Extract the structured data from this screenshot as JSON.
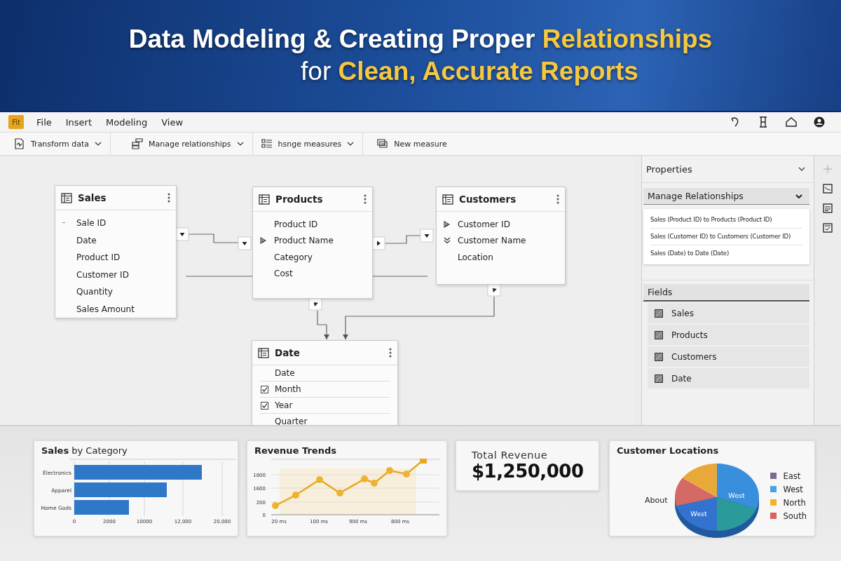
{
  "banner": {
    "lines": [
      [
        {
          "text": "Data Modeling & Creating Proper ",
          "highlight": false
        },
        {
          "text": "Relationships",
          "highlight": true
        }
      ],
      [
        {
          "text": "for ",
          "highlight": false
        },
        {
          "text": "Clean, Accurate Reports",
          "highlight": true
        }
      ]
    ]
  },
  "app_logo": "Fit",
  "menu": [
    "File",
    "Insert",
    "Modeling",
    "View"
  ],
  "toolbar": [
    {
      "label": "Transform data",
      "dropdown": true
    },
    {
      "label": "Manage relationships",
      "dropdown": true
    },
    {
      "label": "hsnge measures",
      "dropdown": true
    },
    {
      "label": "New measure",
      "dropdown": false
    }
  ],
  "tables": [
    {
      "name": "Sales",
      "fields": [
        {
          "label": "Sale ID",
          "kind": "dash"
        },
        {
          "label": "Date",
          "kind": "plain"
        },
        {
          "label": "Product ID",
          "kind": "plain"
        },
        {
          "label": "Customer ID",
          "kind": "plain"
        },
        {
          "label": "Quantity",
          "kind": "plain"
        },
        {
          "label": "Sales Amount",
          "kind": "plain"
        }
      ]
    },
    {
      "name": "Products",
      "fields": [
        {
          "label": "Product ID",
          "kind": "plain"
        },
        {
          "label": "Product Name",
          "kind": "arrow"
        },
        {
          "label": "Category",
          "kind": "plain"
        },
        {
          "label": "Cost",
          "kind": "plain"
        }
      ]
    },
    {
      "name": "Customers",
      "fields": [
        {
          "label": "Customer ID",
          "kind": "arrow"
        },
        {
          "label": "Customer Name",
          "kind": "chevrons"
        },
        {
          "label": "Location",
          "kind": "plain"
        }
      ]
    },
    {
      "name": "Date",
      "fields": [
        {
          "label": "Date",
          "kind": "plain"
        },
        {
          "label": "Month",
          "kind": "checkbox",
          "checked": true
        },
        {
          "label": "Year",
          "kind": "checkbox",
          "checked": true
        },
        {
          "label": "Quarter",
          "kind": "plain"
        }
      ]
    }
  ],
  "properties": {
    "title": "Properties",
    "relationships": {
      "title": "Manage Relationships",
      "items": [
        "Sales (Product ID)  to Products (Product ID)",
        "Sales (Customer ID) to Customers (Customer ID)",
        "Sales (Date)  to Date (Date)"
      ]
    },
    "fields": {
      "title": "Fields",
      "items": [
        "Sales",
        "Products",
        "Customers",
        "Date"
      ]
    }
  },
  "cards": {
    "sales_by_category": {
      "title": "**Sales** by Category",
      "categories": [
        "Electronics",
        "Apparel",
        "Home Gods"
      ],
      "xticks": [
        "0",
        "2000",
        "10000",
        "12,000",
        "20,000"
      ]
    },
    "revenue_trends": {
      "title": "Revenue Trends",
      "yticks": [
        "1800",
        "1600",
        "200",
        "0"
      ],
      "xticks": [
        "20 ms",
        "100 ms",
        "900 ms",
        "800 ms"
      ]
    },
    "total_revenue": {
      "label": "Total Revenue",
      "value": "$1,250,000"
    },
    "customer_locations": {
      "title": "Customer Locations",
      "side_label": "About",
      "slice_labels": [
        "West",
        "West"
      ],
      "legend": [
        {
          "label": "East",
          "color": "#7b6b8c"
        },
        {
          "label": "West",
          "color": "#4aa3df"
        },
        {
          "label": "North",
          "color": "#f0b429"
        },
        {
          "label": "South",
          "color": "#d9625e"
        }
      ]
    }
  }
}
